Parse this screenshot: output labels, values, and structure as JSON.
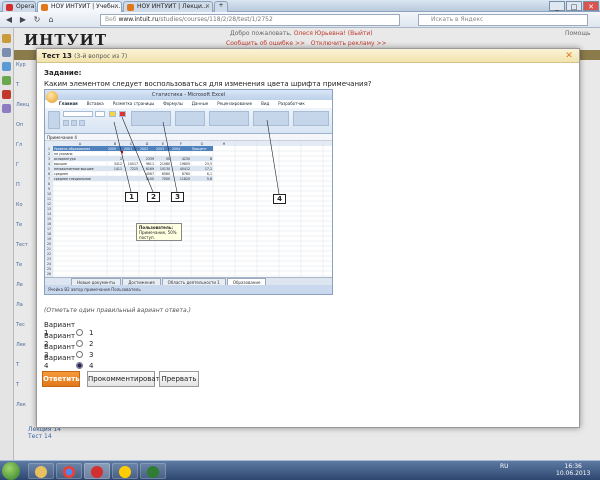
{
  "browser": {
    "tabs": [
      {
        "label": "Opera",
        "color": "#d32f2f"
      },
      {
        "label": "НОУ ИНТУИТ | Учебн...",
        "color": "#e0781a"
      },
      {
        "label": "НОУ ИНТУИТ | Лекци...",
        "color": "#e0781a"
      }
    ],
    "new_tab": "+",
    "win_min": "_",
    "win_max": "□",
    "win_close": "✕",
    "back": "◀",
    "forward": "▶",
    "reload": "↻",
    "home": "⌂",
    "url_prefix": "Веб",
    "url_host": "www.intuit.ru",
    "url_path": "/studies/courses/118/2/28/test/1/2752",
    "search_placeholder": "Искать в Яндекс"
  },
  "site": {
    "logo": "ИНТУИТ",
    "top_prefix": "Добро пожаловать,",
    "user": "Олеся Юрьевна!",
    "logout": "(Выйти)",
    "right_link": "Помощь",
    "error_link": "Сообщить об ошибке >>",
    "ads_link": "Отключить рекламу >>",
    "left_fragments": [
      "Кур",
      "Т",
      "Лекц",
      "Оп",
      "Гл",
      "Г",
      "П",
      "Ко",
      "Те",
      "Тест",
      "Те",
      "Ле",
      "Ла",
      "Тес",
      "Лек",
      "Т",
      "Т",
      "Лек"
    ],
    "bottom_links": [
      "Лекция 14",
      "Тест 14"
    ]
  },
  "dialog": {
    "title": "Тест 13",
    "subtitle": "(3-й вопрос из 7)",
    "close": "✕",
    "task_label": "Задание:",
    "question": "Каким элементом следует воспользоваться для изменения цвета шрифта примечания?",
    "hint": "(Отметьте один правильный вариант ответа.)",
    "options": [
      {
        "label": "Вариант 1",
        "value": "1",
        "selected": false
      },
      {
        "label": "Вариант 2",
        "value": "2",
        "selected": false
      },
      {
        "label": "Вариант 3",
        "value": "3",
        "selected": false
      },
      {
        "label": "Вариант 4",
        "value": "4",
        "selected": true
      }
    ],
    "buttons": {
      "answer": "Ответить",
      "comment": "Прокомментировать",
      "skip": "Прервать"
    }
  },
  "excel": {
    "title": "Статистика - Microsoft Excel",
    "ribbon_tabs": [
      "Главная",
      "Вставка",
      "Разметка страницы",
      "Формулы",
      "Данные",
      "Рецензирование",
      "Вид",
      "Разработчик"
    ],
    "callouts": [
      "1",
      "2",
      "3",
      "4"
    ],
    "tooltip_title": "Пользователь:",
    "tooltip_text": "Примечание, 50% поступ.",
    "name_box": "Примечание 4",
    "sheet_tabs": [
      "Новые документы",
      "Достижения",
      "Область деятельности 1",
      "Образование"
    ],
    "status": "Ячейка B2 автор примечания Пользователь",
    "col_headers": [
      "A",
      "B",
      "C",
      "D",
      "E",
      "F",
      "G",
      "H"
    ],
    "table_header": [
      "Уровень образования",
      "2000",
      "2001",
      "2002",
      "2003",
      "2004",
      "Процент"
    ],
    "table_rows": [
      [
        "не указано",
        "",
        "",
        "",
        "",
        "",
        ""
      ],
      [
        "аспирантура",
        "2",
        "",
        "2339",
        "50",
        "4230",
        "8"
      ],
      [
        "высшее",
        "3412",
        "10017",
        "9611",
        "21080",
        "19805",
        "23,5"
      ],
      [
        "незаконченное высшее",
        "1411",
        "7225",
        "6169",
        "10130",
        "40412",
        "17,1"
      ],
      [
        "среднее",
        "",
        "",
        "4567",
        "6580",
        "8760",
        "6,1"
      ],
      [
        "среднее специальное",
        "",
        "",
        "5100",
        "7000",
        "11820",
        "5,6"
      ]
    ],
    "row_numbers": [
      "1",
      "2",
      "3",
      "4",
      "5",
      "6",
      "7",
      "8",
      "9",
      "10",
      "11",
      "12",
      "13",
      "14",
      "15",
      "16",
      "17",
      "18",
      "19",
      "20",
      "21",
      "22",
      "23",
      "24",
      "25",
      "26",
      "27"
    ]
  },
  "taskbar": {
    "lang": "RU",
    "time": "16:36",
    "date": "10.06.2013"
  },
  "colors": {
    "accent": "#e0781a",
    "dialog_header": "#f1e3ad",
    "link": "#c0392b"
  }
}
